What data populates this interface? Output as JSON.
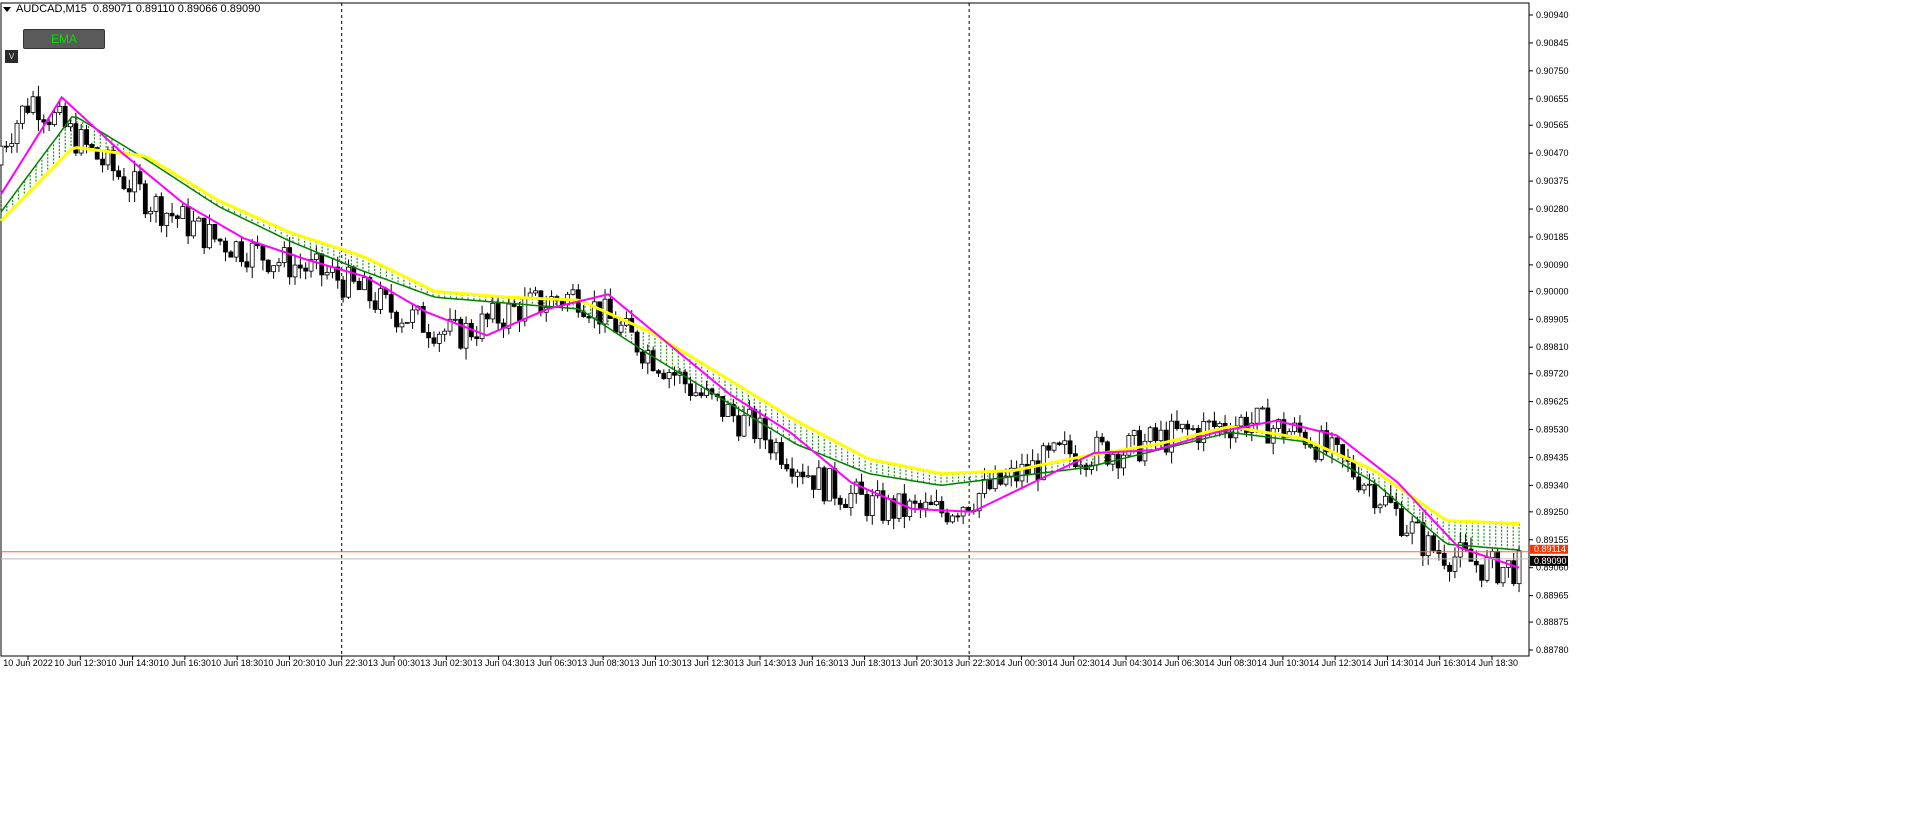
{
  "header": {
    "symbol": "AUDCAD,M15",
    "ohlc": "0.89071 0.89110 0.89066 0.89090"
  },
  "controls": {
    "ema_button": "EMA",
    "v_button": "V"
  },
  "colors": {
    "background": "#ffffff",
    "magenta_ema": "#ff00ff",
    "ribbon_yellow": "#ffff00",
    "ribbon_green": "#008000",
    "bid_line": "#ff6633",
    "price_tag": "#000000",
    "bid_tag": "#ff3300"
  },
  "chart_data": {
    "type": "line",
    "title": "",
    "xlabel": "",
    "ylabel": "",
    "ylim": [
      0.8878,
      0.9094
    ],
    "yticks": [
      "0.90940",
      "0.90845",
      "0.90750",
      "0.90655",
      "0.90565",
      "0.90470",
      "0.90375",
      "0.90280",
      "0.90185",
      "0.90090",
      "0.90000",
      "0.89905",
      "0.89810",
      "0.89720",
      "0.89625",
      "0.89530",
      "0.89435",
      "0.89340",
      "0.89250",
      "0.89155",
      "0.89060",
      "0.88965",
      "0.88875",
      "0.88780"
    ],
    "xticks": [
      "10 Jun 2022",
      "10 Jun 12:30",
      "10 Jun 14:30",
      "10 Jun 16:30",
      "10 Jun 18:30",
      "10 Jun 20:30",
      "10 Jun 22:30",
      "13 Jun 00:30",
      "13 Jun 02:30",
      "13 Jun 04:30",
      "13 Jun 06:30",
      "13 Jun 08:30",
      "13 Jun 10:30",
      "13 Jun 12:30",
      "13 Jun 14:30",
      "13 Jun 16:30",
      "13 Jun 18:30",
      "13 Jun 20:30",
      "13 Jun 22:30",
      "14 Jun 00:30",
      "14 Jun 02:30",
      "14 Jun 04:30",
      "14 Jun 06:30",
      "14 Jun 08:30",
      "14 Jun 10:30",
      "14 Jun 12:30",
      "14 Jun 14:30",
      "14 Jun 16:30",
      "14 Jun 18:30"
    ],
    "period_separators": [
      "10 Jun 22:30",
      "13 Jun 22:30"
    ],
    "bid_price": "0.89114",
    "last_price": "0.89090",
    "series": [
      {
        "name": "",
        "color": "#ff00ff",
        "values": [
          0.9033,
          0.9066,
          0.9047,
          0.903,
          0.9018,
          0.9011,
          0.9005,
          0.8993,
          0.8985,
          0.8994,
          0.8999,
          0.8982,
          0.8965,
          0.8952,
          0.8935,
          0.8926,
          0.8925,
          0.8935,
          0.8945,
          0.8946,
          0.8952,
          0.8956,
          0.8951,
          0.8935,
          0.8913,
          0.8906
        ]
      },
      {
        "name": "",
        "color": "#ffff00",
        "values": [
          0.9024,
          0.9049,
          0.9046,
          0.9031,
          0.902,
          0.9012,
          0.9,
          0.8998,
          0.8997,
          0.8986,
          0.8971,
          0.8956,
          0.8943,
          0.8938,
          0.8939,
          0.8944,
          0.8948,
          0.8954,
          0.895,
          0.8939,
          0.8922,
          0.8921
        ]
      },
      {
        "name": "",
        "color": "#008000",
        "values": [
          0.9027,
          0.906,
          0.9045,
          0.9029,
          0.9017,
          0.9007,
          0.8998,
          0.8996,
          0.8994,
          0.8978,
          0.8963,
          0.8948,
          0.8938,
          0.8934,
          0.8937,
          0.894,
          0.8946,
          0.8952,
          0.8949,
          0.8935,
          0.8914,
          0.8912
        ]
      }
    ]
  }
}
